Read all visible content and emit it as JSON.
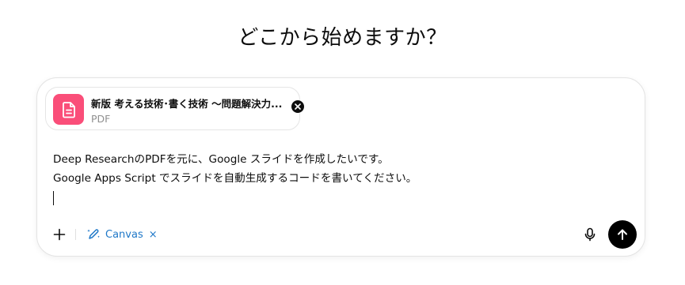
{
  "heading": "どこから始めますか？",
  "attachment": {
    "file_name": "新版 考える技術･書く技術 〜問題解決力...",
    "file_type": "PDF",
    "icon": "document-icon",
    "icon_color": "#fa4e79"
  },
  "prompt": {
    "lines": [
      "Deep ResearchのPDFを元に、Google スライドを作成したいです。",
      "Google Apps Script でスライドを自動生成するコードを書いてください。"
    ]
  },
  "toolbar": {
    "canvas_label": "Canvas",
    "canvas_close": "×",
    "accent_color": "#1f78c8"
  },
  "send_button_color": "#000000"
}
